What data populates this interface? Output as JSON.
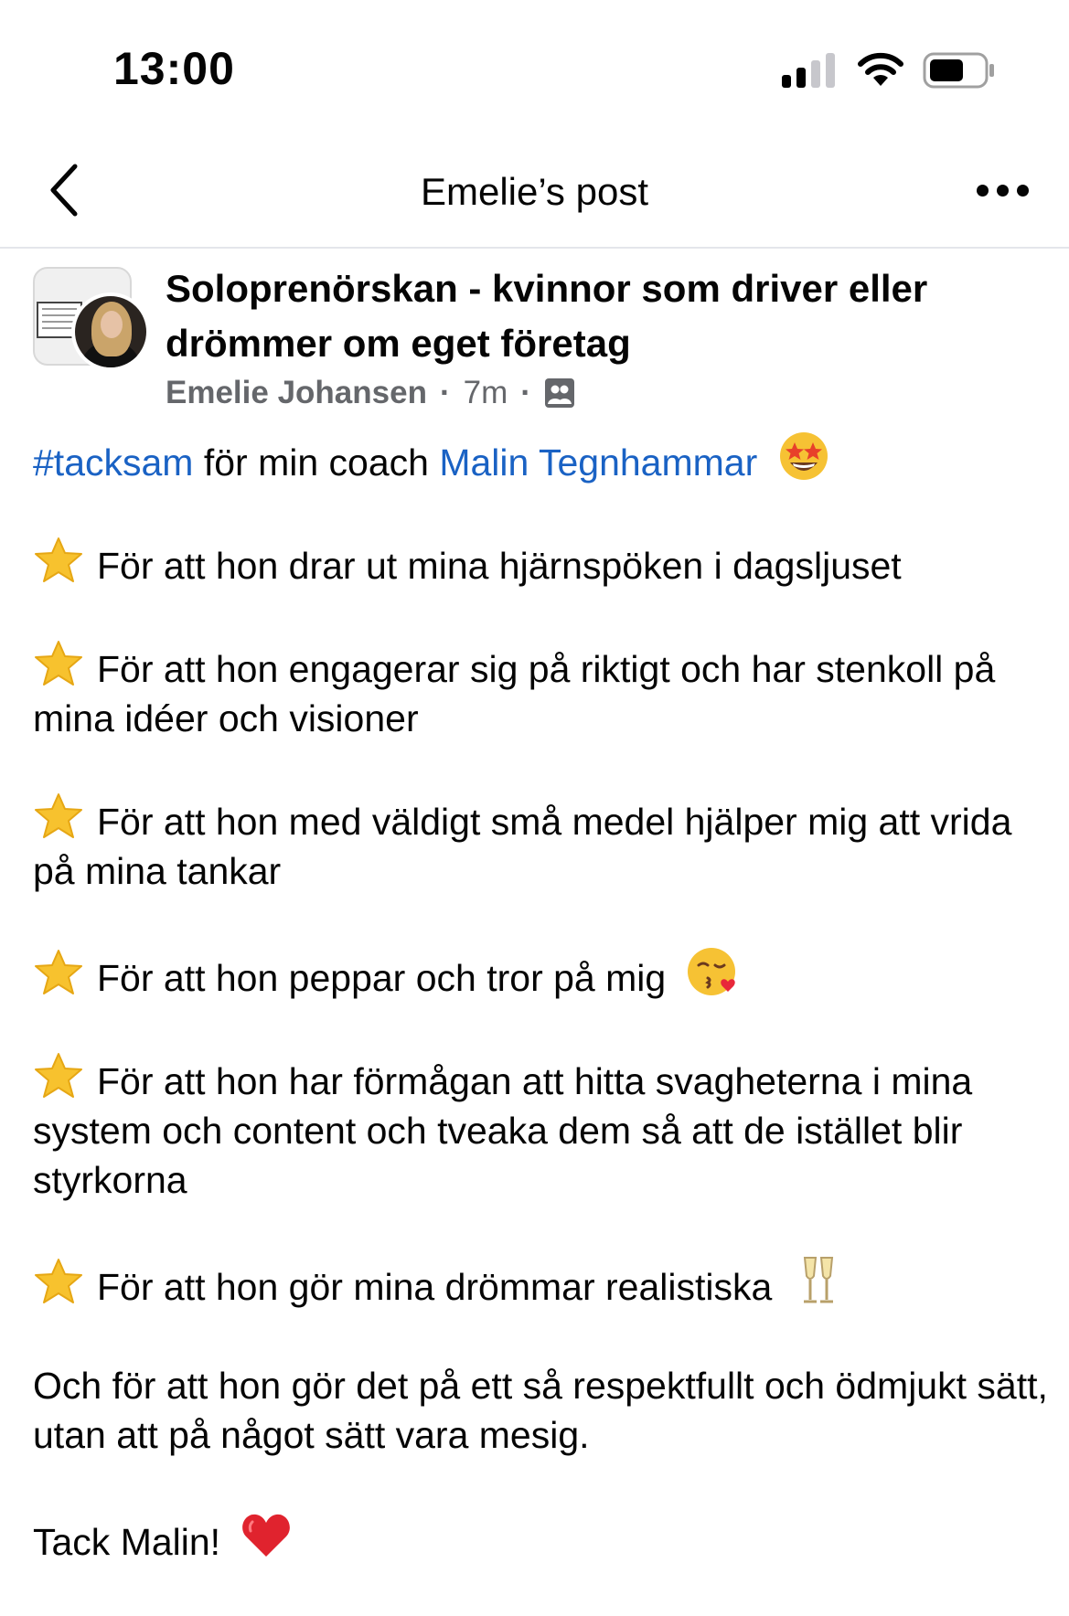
{
  "status_bar": {
    "time": "13:00",
    "signal_icon": "cellular-signal-icon",
    "wifi_icon": "wifi-icon",
    "battery_icon": "battery-icon"
  },
  "nav": {
    "back_icon": "chevron-left-icon",
    "title": "Emelie’s post",
    "more_icon": "more-horizontal-icon"
  },
  "post": {
    "group_name": "Soloprenörskan - kvinnor som driver eller drömmer om eget företag",
    "author": "Emelie Johansen",
    "separator": "·",
    "age": "7m",
    "audience_icon": "group-members-icon",
    "intro": {
      "hashtag": "#tacksam",
      "text": " för min coach ",
      "mention": "Malin Tegnhammar",
      "emoji": "star-struck-emoji"
    },
    "items": [
      {
        "text": "För att hon drar ut mina hjärnspöken i dagsljuset",
        "emoji": ""
      },
      {
        "text": "För att hon engagerar sig på riktigt och har stenkoll på mina idéer och visioner",
        "emoji": ""
      },
      {
        "text": "För att hon med väldigt små medel hjälper mig att vrida på mina tankar",
        "emoji": ""
      },
      {
        "text": "För att hon peppar och tror på mig",
        "emoji": "kissing-heart-emoji"
      },
      {
        "text": "För att hon har förmågan att hitta svagheterna i mina system och content och tveaka dem så att de istället blir styrkorna",
        "emoji": ""
      },
      {
        "text": "För att hon gör mina drömmar realistiska",
        "emoji": "clinking-glasses-emoji"
      }
    ],
    "closing": "Och för att hon gör det på ett så respektfullt och ödmjukt sätt, utan att på något sätt vara mesig.",
    "thanks": "Tack Malin!",
    "thanks_emoji": "red-heart-emoji"
  },
  "colors": {
    "link": "#1a62c4",
    "meta": "#65676b",
    "text": "#050505",
    "star": "#f7c22e"
  }
}
